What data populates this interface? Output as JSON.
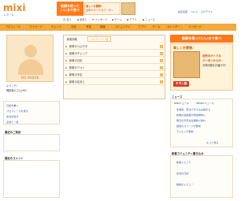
{
  "header": {
    "logo": "mixi",
    "home_label": "ホーム",
    "banner_line1": "新鮮を取って",
    "banner_line2": "いいまで食べ",
    "banner_sub1": "楽しくお買物♪",
    "banner_sub2": "近所のオトクなクーポン",
    "top_links": [
      "設定変更",
      "ヘルプ",
      "ログアウト"
    ]
  },
  "nav": [
    "友人",
    "足あと",
    "メッセージ",
    "ゲーム",
    "アプリ",
    "ニュース"
  ],
  "tabs": [
    "プロフィール",
    "マイページ",
    "チェック",
    "日記",
    "写真",
    "動画",
    "コミュニティ",
    "アプリ",
    "ゲーム",
    "カレンダー",
    "メッセージ"
  ],
  "profile": {
    "no_image": "NO IMAGE",
    "edit_link": "ようこそ！",
    "name_text": "梶田典人さん(99)"
  },
  "left_menu": [
    "日記を書く",
    "プロフィールを見る",
    "友達を探す",
    "足あと一覧"
  ],
  "main": {
    "sub_tabs": [
      "新着情報",
      "コンテンツ一覧"
    ],
    "rows": [
      "新着のつぶやき",
      "新着のチェック",
      "新着の日記",
      "新着のフォト",
      "新着の予定",
      "新着の足あと"
    ]
  },
  "right_ad": {
    "line1": "新鮮を取っていいまで食べ",
    "line2": "楽しくお買物♪",
    "line3": "近所のオトクな",
    "line4": "クーポンからの",
    "line5": "お得情報をお届け中！",
    "badge": "チラシ部"
  },
  "news": {
    "title": "ニュース",
    "tabs": [
      "mixiニュース",
      "Yahoo!ニュース"
    ],
    "items": [
      "北海道、東北で冷え込み強まる",
      "新規の感染者が増加傾向に",
      "明日の天気は全国的に晴れ",
      "話題のスイーツが登場",
      "ランキング更新"
    ],
    "more": "もっと見る"
  },
  "community": {
    "title": "新着コミュニティ書き込み",
    "items": [
      "新着トピック",
      "友達の日記",
      "映画のレビュー"
    ]
  },
  "left_sections": {
    "section1": "最近のご来訪",
    "section2": "最近のコメント"
  },
  "colors": {
    "accent": "#f3a93c",
    "link": "#2a5aa8",
    "ad": "#ff7a1a"
  }
}
